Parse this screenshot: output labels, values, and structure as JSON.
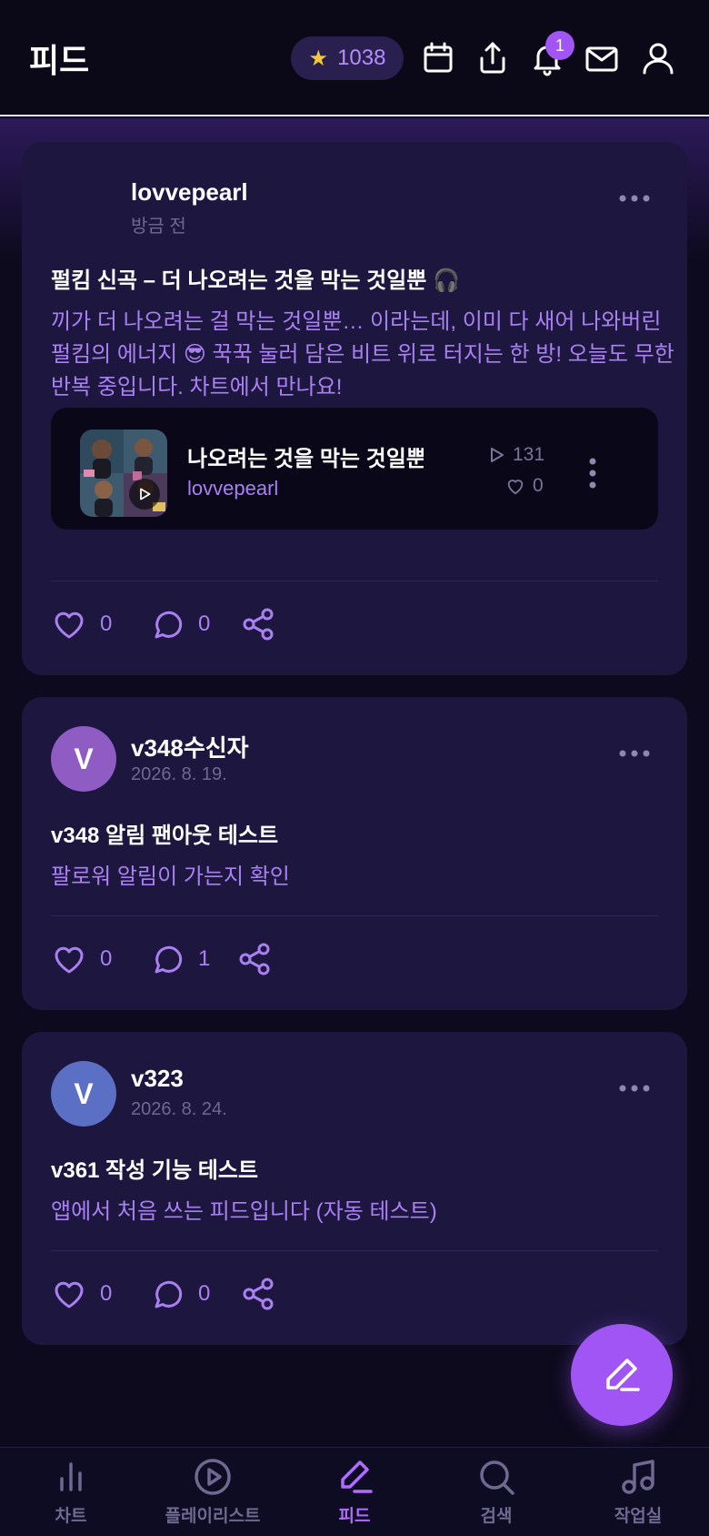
{
  "header": {
    "title": "피드",
    "points": "1038",
    "notification_count": "1",
    "icons": [
      "calendar-icon",
      "share-upload-icon",
      "bell-icon",
      "mail-icon",
      "user-icon"
    ]
  },
  "posts": [
    {
      "author": "lovvepearl",
      "time": "방금 전",
      "title": "펄킴 신곡 – 더 나오려는 것을 막는 것일뿐 🎧",
      "body": "끼가 더 나오려는 걸 막는 것일뿐… 이라는데, 이미 다 새어 나와버린 펄킴의 에너지 😎  꾹꾹 눌러 담은 비트 위로 터지는 한 방! 오늘도 무한반복 중입니다. 차트에서 만나요!",
      "track": {
        "title": "나오려는 것을 막는 것일뿐",
        "artist": "lovvepearl",
        "plays": "131",
        "likes": "0"
      },
      "likes": "0",
      "comments": "0"
    },
    {
      "avatar_letter": "V",
      "avatar_color": "#8f5cc4",
      "author": "v348수신자",
      "time": "2026. 8. 19.",
      "title": "v348 알림 팬아웃 테스트",
      "body": "팔로워 알림이 가는지 확인",
      "likes": "0",
      "comments": "1"
    },
    {
      "avatar_letter": "V",
      "avatar_color": "#5b6fc4",
      "author": "v323",
      "time": "2026. 8. 24.",
      "title": "v361 작성 기능 테스트",
      "body": "앱에서 처음 쓰는 피드입니다 (자동 테스트)",
      "likes": "0",
      "comments": "0"
    }
  ],
  "tabs": [
    {
      "label": "차트",
      "icon": "chart-bars-icon"
    },
    {
      "label": "플레이리스트",
      "icon": "play-circle-icon"
    },
    {
      "label": "피드",
      "icon": "pencil-icon",
      "active": true
    },
    {
      "label": "검색",
      "icon": "search-icon"
    },
    {
      "label": "작업실",
      "icon": "music-note-icon"
    }
  ],
  "colors": {
    "accent": "#a155f5",
    "text_accent": "#a980f2",
    "card": "#1d1740",
    "background": "#0c0a1c"
  }
}
